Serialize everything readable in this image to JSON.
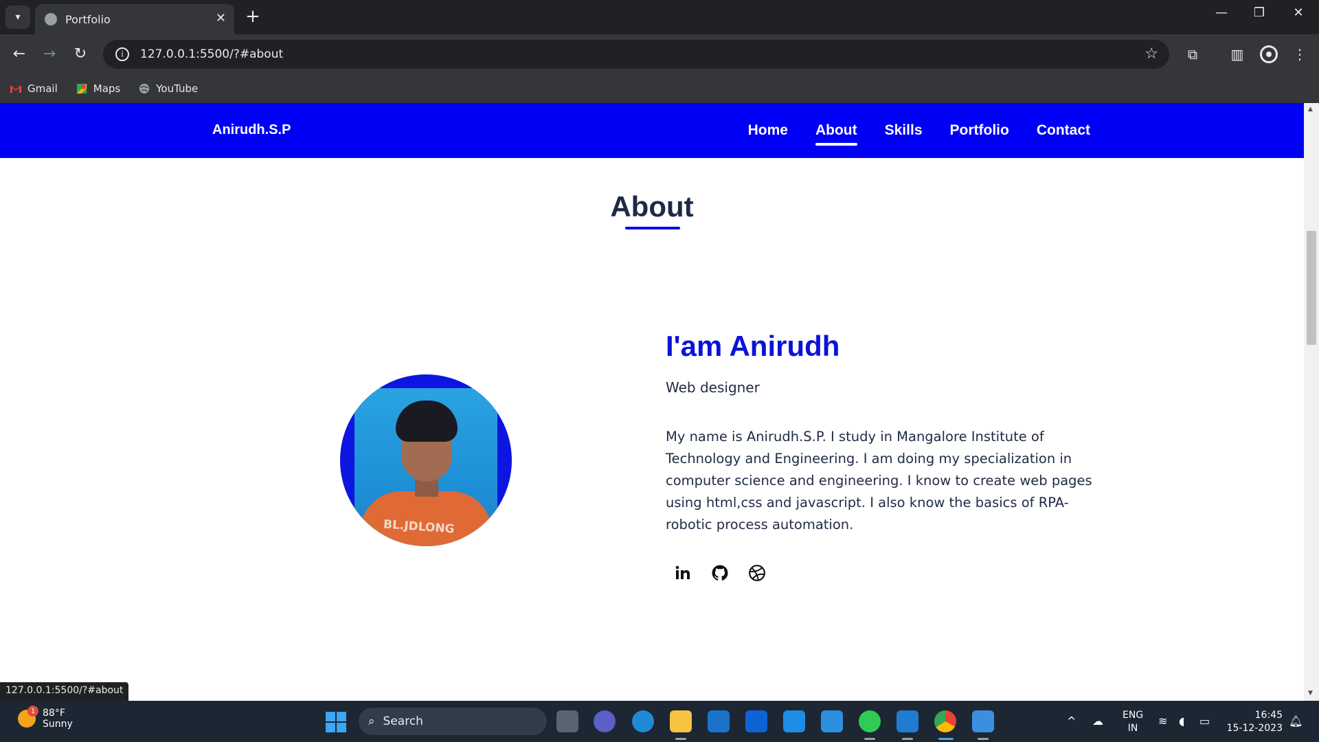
{
  "browser": {
    "tab_title": "Portfolio",
    "url": "127.0.0.1:5500/?#about",
    "bookmarks": [
      {
        "label": "Gmail",
        "icon": "gmail-icon"
      },
      {
        "label": "Maps",
        "icon": "maps-icon"
      },
      {
        "label": "YouTube",
        "icon": "globe-icon"
      }
    ],
    "status_url": "127.0.0.1:5500/?#about"
  },
  "site": {
    "brand": "Anirudh.S.P",
    "nav": [
      {
        "label": "Home",
        "active": false
      },
      {
        "label": "About",
        "active": true
      },
      {
        "label": "Skills",
        "active": false
      },
      {
        "label": "Portfolio",
        "active": false
      },
      {
        "label": "Contact",
        "active": false
      }
    ],
    "section_title": "About",
    "greeting": "I'am Anirudh",
    "role": "Web designer",
    "bio": "My name is Anirudh.S.P. I study in Mangalore Institute of Technology and Engineering. I am doing my specialization in computer science and engineering. I know to create web pages using html,css and javascript. I also know the basics of RPA-robotic process automation.",
    "photo_shirt_text": "BL.JDLONG",
    "socials": [
      "linkedin-icon",
      "github-icon",
      "dribbble-icon"
    ],
    "accent_color": "#0000f5"
  },
  "taskbar": {
    "weather_temp": "88°F",
    "weather_desc": "Sunny",
    "weather_badge": "1",
    "search_placeholder": "Search",
    "lang_top": "ENG",
    "lang_bottom": "IN",
    "time": "16:45",
    "date": "15-12-2023"
  }
}
